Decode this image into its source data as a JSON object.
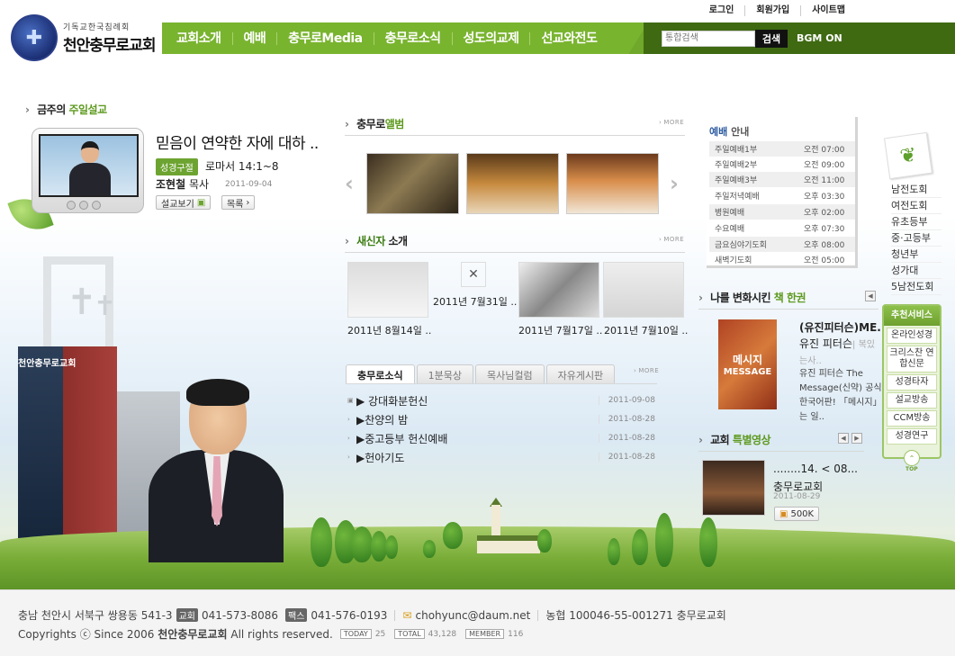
{
  "header": {
    "top_links": [
      "로그인",
      "회원가입",
      "사이트맵"
    ],
    "logo_sub": "기독교한국침례회",
    "logo_main": "천안충무로교회",
    "menu": [
      "교회소개",
      "예배",
      "충무로Media",
      "충무로소식",
      "성도의교제",
      "선교와전도"
    ],
    "search_placeholder": "통합검색",
    "search_button": "검색",
    "bgm": "BGM ON"
  },
  "sermon": {
    "section_prefix": "금주의",
    "section_highlight": "주일설교",
    "title": "믿음이 연약한 자에 대하 ..",
    "badge": "성경구절",
    "reference": "로마서 14:1~8",
    "preacher_name": "조현철",
    "preacher_title": "목사",
    "date": "2011-09-04",
    "watch_button": "설교보기",
    "list_button": "목록"
  },
  "album": {
    "title_prefix": "충무로",
    "title_highlight": "앨범",
    "more": "MORE"
  },
  "newcomers": {
    "title_highlight": "새신자",
    "title_suffix": "소개",
    "more": "MORE",
    "items": [
      {
        "caption": "2011년 8월14일 .."
      },
      {
        "caption": "2011년  7월31일 .."
      },
      {
        "caption": "2011년 7월17일 .."
      },
      {
        "caption": "2011년  7월10일 .."
      }
    ]
  },
  "news": {
    "tabs": [
      "충무로소식",
      "1분묵상",
      "목사님컬럼",
      "자유게시판"
    ],
    "more": "MORE",
    "rows": [
      {
        "title": "▶ 강대화분헌신",
        "date": "2011-09-08"
      },
      {
        "title": "▶찬양의 밤",
        "date": "2011-08-28"
      },
      {
        "title": "▶중고등부 헌신예배",
        "date": "2011-08-28"
      },
      {
        "title": "▶헌아기도",
        "date": "2011-08-28"
      }
    ]
  },
  "worship": {
    "title_highlight": "예배",
    "title_suffix": "안내",
    "rows": [
      {
        "name": "주일예배1부",
        "time": "오전 07:00"
      },
      {
        "name": "주일예배2부",
        "time": "오전 09:00"
      },
      {
        "name": "주일예배3부",
        "time": "오전 11:00"
      },
      {
        "name": "주일저녁예배",
        "time": "오후 03:30"
      },
      {
        "name": "병원예배",
        "time": "오후 02:00"
      },
      {
        "name": "수요예배",
        "time": "오후 07:30"
      },
      {
        "name": "금요심야기도회",
        "time": "오후 08:00"
      },
      {
        "name": "새벽기도회",
        "time": "오전 05:00"
      }
    ]
  },
  "book": {
    "title_prefix": "나를 변화시킨",
    "title_highlight": "책 한권",
    "cover_text": "메시지",
    "cover_sub": "MESSAGE",
    "name": "(유진피터슨)ME..",
    "author": "유진 피터슨",
    "author_extra": "| 복있는사..",
    "desc": "유진 피터슨 The Message(신약) 공식 한국어판! 「메시지」는 일.."
  },
  "video": {
    "title_prefix": "교회",
    "title_highlight": "특별영상",
    "name": "........14. < 08...",
    "author": "충무로교회",
    "date": "2011-08-29",
    "size": "500K"
  },
  "quick_menu": [
    "남전도회",
    "여전도회",
    "유초등부",
    "중·고등부",
    "청년부",
    "성가대",
    "5남전도회"
  ],
  "recommend": {
    "title": "추천서비스",
    "items": [
      "온라인성경",
      "크리스찬 연합신문",
      "성경타자",
      "설교방송",
      "CCM방송",
      "성경연구"
    ],
    "top": "TOP"
  },
  "footer": {
    "address": "충남 천안시 서북구 쌍용동 541-3",
    "tel_tag": "교회",
    "tel": "041-573-8086",
    "fax_tag": "팩스",
    "fax": "041-576-0193",
    "email": "chohyunc@daum.net",
    "bank": "농협 100046-55-001271 충무로교회",
    "copyright_prefix": "Copyrights ⓒ Since 2006",
    "copyright_name": "천안충무로교회",
    "copyright_suffix": "All rights reserved.",
    "today_label": "TODAY",
    "today": "25",
    "total_label": "TOTAL",
    "total": "43,128",
    "member_label": "MEMBER",
    "member": "116"
  }
}
